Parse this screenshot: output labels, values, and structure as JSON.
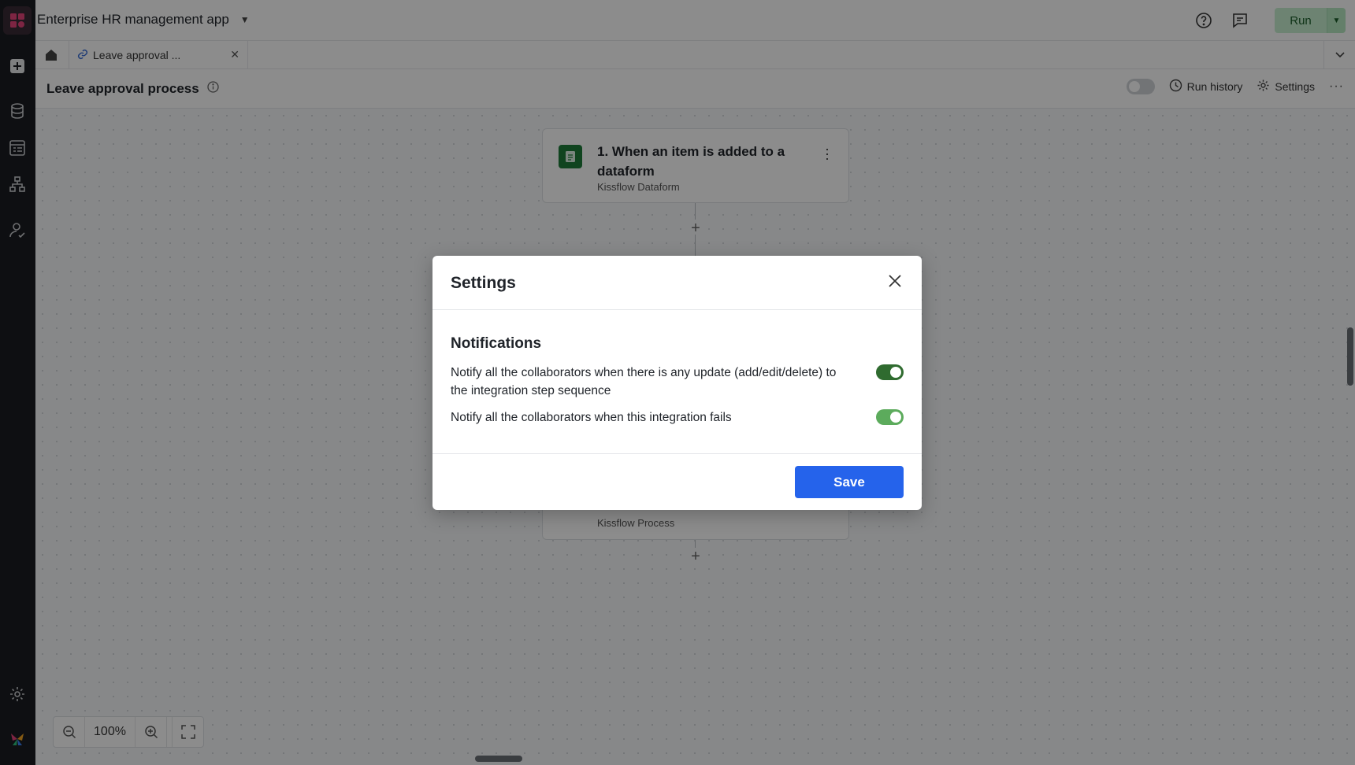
{
  "app": {
    "title": "Enterprise HR management app",
    "run_label": "Run"
  },
  "tabs": {
    "active_tab_label": "Leave approval ..."
  },
  "header": {
    "page_title": "Leave approval process",
    "run_history_label": "Run history",
    "settings_label": "Settings"
  },
  "flow": {
    "steps": [
      {
        "title": "1. When an item is added to a dataform",
        "subtitle": "Kissflow Dataform"
      },
      {
        "title": "",
        "subtitle": "Kissflow Process"
      }
    ]
  },
  "zoom": {
    "level": "100%"
  },
  "modal": {
    "title": "Settings",
    "section_title": "Notifications",
    "settings": [
      {
        "label": "Notify all the collaborators when there is any update (add/edit/delete) to the integration step sequence",
        "enabled": true
      },
      {
        "label": "Notify all the collaborators when this integration fails",
        "enabled": true
      }
    ],
    "save_label": "Save"
  },
  "colors": {
    "rail_bg": "#1b1d21",
    "toggle_on_dark": "#2f6b2f",
    "toggle_on_light": "#5cab5c",
    "save_button": "#2563eb"
  }
}
